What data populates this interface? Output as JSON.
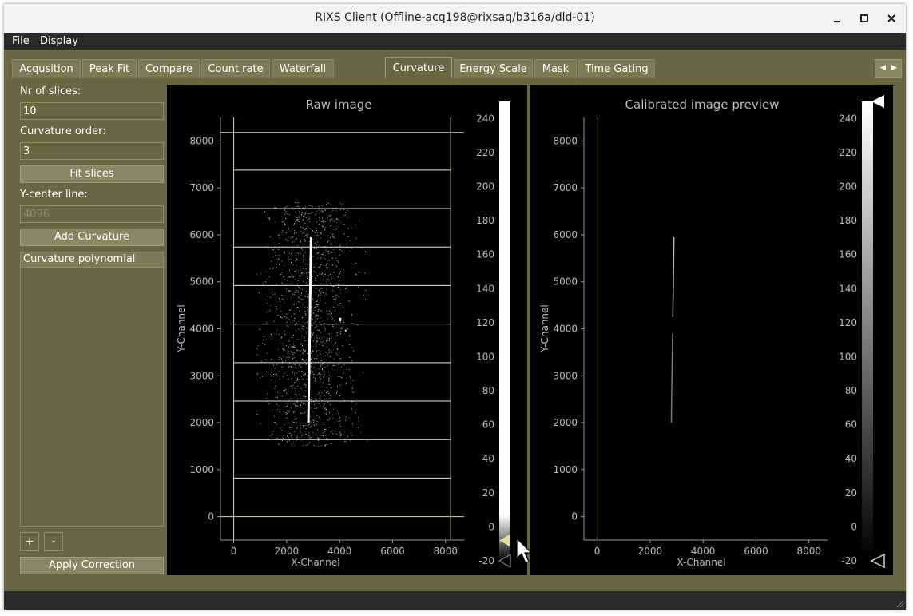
{
  "window": {
    "title": "RIXS Client (Offline-acq198@rixsaq/b316a/dld-01)"
  },
  "menu": {
    "file": "File",
    "display": "Display"
  },
  "tabs_left": [
    "Acqusition",
    "Peak Fit",
    "Compare",
    "Count rate",
    "Waterfall"
  ],
  "tabs_right": [
    "Curvature",
    "Energy Scale",
    "Mask",
    "Time Gating"
  ],
  "active_tab": "Curvature",
  "controls": {
    "slices_label": "Nr of slices:",
    "slices_value": "10",
    "order_label": "Curvature order:",
    "order_value": "3",
    "fit_button": "Fit slices",
    "ycenter_label": "Y-center line:",
    "ycenter_value": "4096",
    "add_curvature": "Add Curvature",
    "list_header": "Curvature polynomial",
    "plus": "+",
    "minus": "-",
    "apply": "Apply Correction"
  },
  "colors": {
    "window_bg": "#6b6642",
    "plot_bg": "#000000",
    "guide_line": "#d8d49a"
  },
  "chart_data": [
    {
      "type": "heatmap",
      "title": "Raw image",
      "xlabel": "X-Channel",
      "ylabel": "Y-Channel",
      "xlim": [
        -500,
        8700
      ],
      "ylim": [
        -500,
        8500
      ],
      "xticks": [
        "0",
        "2000",
        "4000",
        "6000",
        "8000"
      ],
      "yticks": [
        "0",
        "1000",
        "2000",
        "3000",
        "4000",
        "5000",
        "6000",
        "7000",
        "8000"
      ],
      "slice_lines_y": [
        0,
        820,
        1640,
        2460,
        3280,
        4100,
        4920,
        5740,
        6560,
        7380,
        8180
      ],
      "vertical_lines_x": [
        0,
        8192
      ],
      "bright_line": {
        "x_bottom": 2820,
        "y_bottom": 2000,
        "x_top": 2920,
        "y_top": 5950
      },
      "colorbar": {
        "ticks": [
          "240",
          "220",
          "200",
          "180",
          "160",
          "140",
          "120",
          "100",
          "80",
          "60",
          "40",
          "20",
          "0",
          "-20"
        ],
        "min": -20,
        "max": 250
      }
    },
    {
      "type": "heatmap",
      "title": "Calibrated image preview",
      "xlabel": "X-Channel",
      "ylabel": "Y-Channel",
      "xlim": [
        -500,
        8700
      ],
      "ylim": [
        -500,
        8500
      ],
      "xticks": [
        "0",
        "2000",
        "4000",
        "6000",
        "8000"
      ],
      "yticks": [
        "0",
        "1000",
        "2000",
        "3000",
        "4000",
        "5000",
        "6000",
        "7000",
        "8000"
      ],
      "vertical_lines_x": [
        0
      ],
      "bright_line": {
        "x_bottom": 2800,
        "y_bottom": 2000,
        "x_top": 2900,
        "y_top": 5950
      },
      "colorbar": {
        "ticks": [
          "240",
          "220",
          "200",
          "180",
          "160",
          "140",
          "120",
          "100",
          "80",
          "60",
          "40",
          "20",
          "0",
          "-20"
        ],
        "min": -20,
        "max": 250
      }
    }
  ]
}
